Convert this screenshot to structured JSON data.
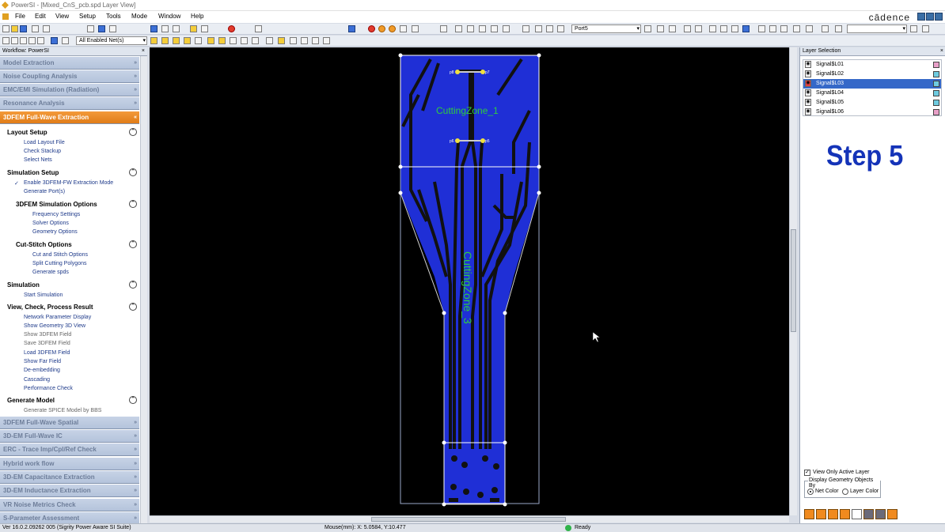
{
  "window": {
    "title": "PowerSI - [Mixed_CnS_pcb.spd Layer View]"
  },
  "menu": [
    "File",
    "Edit",
    "View",
    "Setup",
    "Tools",
    "Mode",
    "Window",
    "Help"
  ],
  "brand": "cādence",
  "toolbar": {
    "net_filter": "All Enabled Net(s)",
    "port_select": "Port5"
  },
  "workflow": {
    "header": "Workflow: PowerSI",
    "top_sections": [
      "Model Extraction",
      "Noise Coupling Analysis",
      "EMC/EMI Simulation (Radiation)",
      "Resonance Analysis"
    ],
    "active_section": "3DFEM Full-Wave Extraction",
    "groups": [
      {
        "title": "Layout Setup",
        "items": [
          "Load Layout File",
          "Check Stackup",
          "Select Nets"
        ]
      },
      {
        "title": "Simulation Setup",
        "items": [
          "Enable 3DFEM-FW Extraction Mode",
          "Generate Port(s)"
        ]
      },
      {
        "title": "3DFEM Simulation Options",
        "items": [
          "Frequency Settings",
          "Solver Options",
          "Geometry Options"
        ]
      },
      {
        "title": "Cut-Stitch Options",
        "items": [
          "Cut and Stitch Options",
          "Split Cutting Polygons",
          "Generate spds"
        ]
      },
      {
        "title": "Simulation",
        "items": [
          "Start Simulation"
        ]
      },
      {
        "title": "View, Check, Process Result",
        "items": [
          "Network Parameter Display",
          "Show Geometry 3D View",
          "Show 3DFEM Field",
          "Save 3DFEM Field",
          "Load 3DFEM Field",
          "Show Far Field",
          "De-embedding",
          "Cascading",
          "Performance Check"
        ]
      },
      {
        "title": "Generate Model",
        "items": [
          "Generate SPICE Model by BBS"
        ]
      }
    ],
    "bottom_sections": [
      "3DFEM Full-Wave Spatial",
      "3D-EM Full-Wave IC",
      "ERC - Trace Imp/Cpl/Ref Check",
      "Hybrid work flow",
      "3D-EM Capacitance Extraction",
      "3D-EM Inductance Extraction",
      "VR Noise Metrics Check",
      "S-Parameter Assessment"
    ]
  },
  "canvas": {
    "zone1": "CuttingZone_1",
    "zone3": "CuttingZone_3",
    "port_labels": [
      "p8",
      "p7",
      "p6",
      "p5"
    ]
  },
  "layers": {
    "header": "Layer Selection",
    "items": [
      "Signal$L01",
      "Signal$L02",
      "Signal$L03",
      "Signal$L04",
      "Signal$L05",
      "Signal$L06"
    ],
    "selected": "Signal$L03",
    "only_active": "View Only Active Layer",
    "display_by": "Display Geometry Objects By",
    "net_color": "Net Color",
    "layer_color": "Layer Color"
  },
  "overlay": {
    "step": "Step 5"
  },
  "status": {
    "version": "Ver 16.0.2.09262  005 (Sigrity Power Aware SI Suite)",
    "mouse": "Mouse(mm): X: 5.0584, Y:10.477",
    "ready": "Ready"
  },
  "colors": {
    "active_section": "#e07c18",
    "copper": "#1f2fd6",
    "zone_text": "#2ecc40",
    "step_text": "#1433b8",
    "selected_layer": "#3568c8"
  }
}
